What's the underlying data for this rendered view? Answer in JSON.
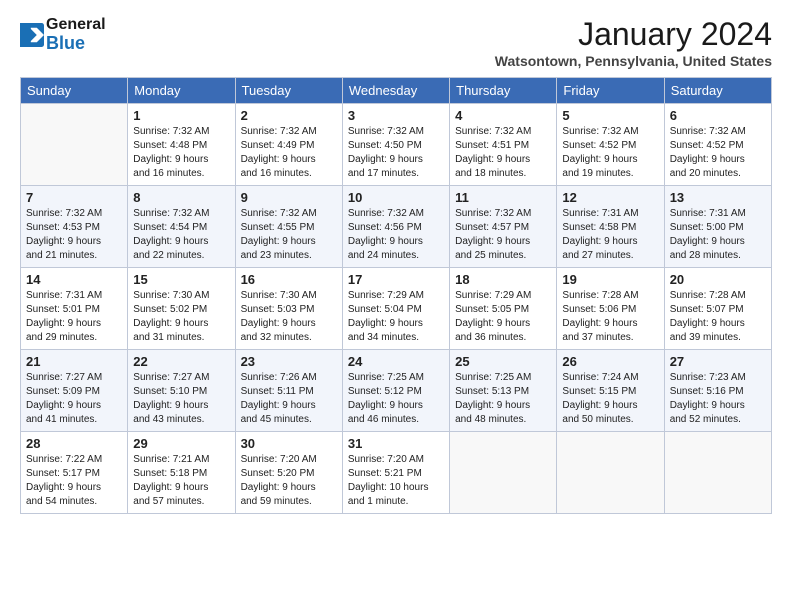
{
  "header": {
    "logo_general": "General",
    "logo_blue": "Blue",
    "month_title": "January 2024",
    "location": "Watsontown, Pennsylvania, United States"
  },
  "days_of_week": [
    "Sunday",
    "Monday",
    "Tuesday",
    "Wednesday",
    "Thursday",
    "Friday",
    "Saturday"
  ],
  "weeks": [
    [
      {
        "day": "",
        "info": ""
      },
      {
        "day": "1",
        "info": "Sunrise: 7:32 AM\nSunset: 4:48 PM\nDaylight: 9 hours\nand 16 minutes."
      },
      {
        "day": "2",
        "info": "Sunrise: 7:32 AM\nSunset: 4:49 PM\nDaylight: 9 hours\nand 16 minutes."
      },
      {
        "day": "3",
        "info": "Sunrise: 7:32 AM\nSunset: 4:50 PM\nDaylight: 9 hours\nand 17 minutes."
      },
      {
        "day": "4",
        "info": "Sunrise: 7:32 AM\nSunset: 4:51 PM\nDaylight: 9 hours\nand 18 minutes."
      },
      {
        "day": "5",
        "info": "Sunrise: 7:32 AM\nSunset: 4:52 PM\nDaylight: 9 hours\nand 19 minutes."
      },
      {
        "day": "6",
        "info": "Sunrise: 7:32 AM\nSunset: 4:52 PM\nDaylight: 9 hours\nand 20 minutes."
      }
    ],
    [
      {
        "day": "7",
        "info": "Sunrise: 7:32 AM\nSunset: 4:53 PM\nDaylight: 9 hours\nand 21 minutes."
      },
      {
        "day": "8",
        "info": "Sunrise: 7:32 AM\nSunset: 4:54 PM\nDaylight: 9 hours\nand 22 minutes."
      },
      {
        "day": "9",
        "info": "Sunrise: 7:32 AM\nSunset: 4:55 PM\nDaylight: 9 hours\nand 23 minutes."
      },
      {
        "day": "10",
        "info": "Sunrise: 7:32 AM\nSunset: 4:56 PM\nDaylight: 9 hours\nand 24 minutes."
      },
      {
        "day": "11",
        "info": "Sunrise: 7:32 AM\nSunset: 4:57 PM\nDaylight: 9 hours\nand 25 minutes."
      },
      {
        "day": "12",
        "info": "Sunrise: 7:31 AM\nSunset: 4:58 PM\nDaylight: 9 hours\nand 27 minutes."
      },
      {
        "day": "13",
        "info": "Sunrise: 7:31 AM\nSunset: 5:00 PM\nDaylight: 9 hours\nand 28 minutes."
      }
    ],
    [
      {
        "day": "14",
        "info": "Sunrise: 7:31 AM\nSunset: 5:01 PM\nDaylight: 9 hours\nand 29 minutes."
      },
      {
        "day": "15",
        "info": "Sunrise: 7:30 AM\nSunset: 5:02 PM\nDaylight: 9 hours\nand 31 minutes."
      },
      {
        "day": "16",
        "info": "Sunrise: 7:30 AM\nSunset: 5:03 PM\nDaylight: 9 hours\nand 32 minutes."
      },
      {
        "day": "17",
        "info": "Sunrise: 7:29 AM\nSunset: 5:04 PM\nDaylight: 9 hours\nand 34 minutes."
      },
      {
        "day": "18",
        "info": "Sunrise: 7:29 AM\nSunset: 5:05 PM\nDaylight: 9 hours\nand 36 minutes."
      },
      {
        "day": "19",
        "info": "Sunrise: 7:28 AM\nSunset: 5:06 PM\nDaylight: 9 hours\nand 37 minutes."
      },
      {
        "day": "20",
        "info": "Sunrise: 7:28 AM\nSunset: 5:07 PM\nDaylight: 9 hours\nand 39 minutes."
      }
    ],
    [
      {
        "day": "21",
        "info": "Sunrise: 7:27 AM\nSunset: 5:09 PM\nDaylight: 9 hours\nand 41 minutes."
      },
      {
        "day": "22",
        "info": "Sunrise: 7:27 AM\nSunset: 5:10 PM\nDaylight: 9 hours\nand 43 minutes."
      },
      {
        "day": "23",
        "info": "Sunrise: 7:26 AM\nSunset: 5:11 PM\nDaylight: 9 hours\nand 45 minutes."
      },
      {
        "day": "24",
        "info": "Sunrise: 7:25 AM\nSunset: 5:12 PM\nDaylight: 9 hours\nand 46 minutes."
      },
      {
        "day": "25",
        "info": "Sunrise: 7:25 AM\nSunset: 5:13 PM\nDaylight: 9 hours\nand 48 minutes."
      },
      {
        "day": "26",
        "info": "Sunrise: 7:24 AM\nSunset: 5:15 PM\nDaylight: 9 hours\nand 50 minutes."
      },
      {
        "day": "27",
        "info": "Sunrise: 7:23 AM\nSunset: 5:16 PM\nDaylight: 9 hours\nand 52 minutes."
      }
    ],
    [
      {
        "day": "28",
        "info": "Sunrise: 7:22 AM\nSunset: 5:17 PM\nDaylight: 9 hours\nand 54 minutes."
      },
      {
        "day": "29",
        "info": "Sunrise: 7:21 AM\nSunset: 5:18 PM\nDaylight: 9 hours\nand 57 minutes."
      },
      {
        "day": "30",
        "info": "Sunrise: 7:20 AM\nSunset: 5:20 PM\nDaylight: 9 hours\nand 59 minutes."
      },
      {
        "day": "31",
        "info": "Sunrise: 7:20 AM\nSunset: 5:21 PM\nDaylight: 10 hours\nand 1 minute."
      },
      {
        "day": "",
        "info": ""
      },
      {
        "day": "",
        "info": ""
      },
      {
        "day": "",
        "info": ""
      }
    ]
  ]
}
